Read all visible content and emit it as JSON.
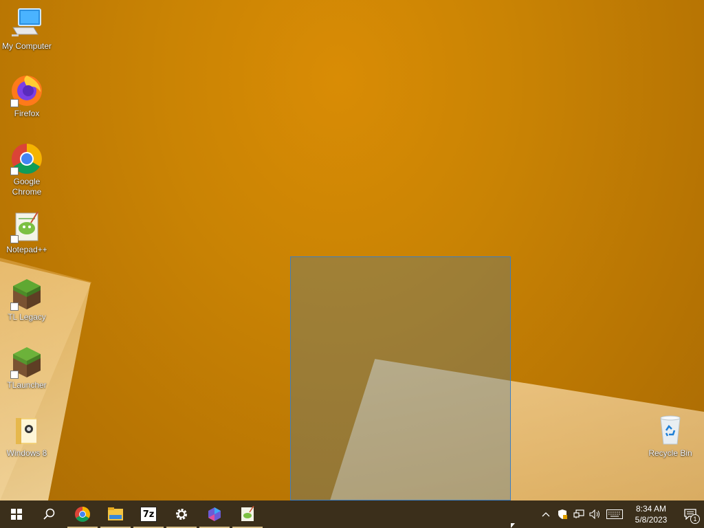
{
  "desktop": {
    "icons": [
      {
        "label": "My Computer",
        "icon": "computer-icon"
      },
      {
        "label": "Firefox",
        "icon": "firefox-icon"
      },
      {
        "label": "Google Chrome",
        "icon": "chrome-icon"
      },
      {
        "label": "Notepad++",
        "icon": "notepadpp-icon"
      },
      {
        "label": "TL Legacy",
        "icon": "minecraft-grass-icon"
      },
      {
        "label": "TLauncher",
        "icon": "minecraft-grass-icon"
      },
      {
        "label": "Windows 8",
        "icon": "folder-icon"
      }
    ],
    "recycle_bin": {
      "label": "Recycle Bin",
      "icon": "recycle-bin-icon"
    }
  },
  "taskbar": {
    "pinned": [
      "start",
      "search",
      "chrome",
      "file-explorer",
      "7-zip",
      "settings",
      "app",
      "notepad"
    ],
    "seven_zip_label": "7z",
    "clock": {
      "time": "8:34 AM",
      "date": "5/8/2023"
    },
    "notification_count": "1"
  },
  "colors": {
    "taskbar": "#3b2f1b",
    "selection_border": "#3b7fc4"
  }
}
